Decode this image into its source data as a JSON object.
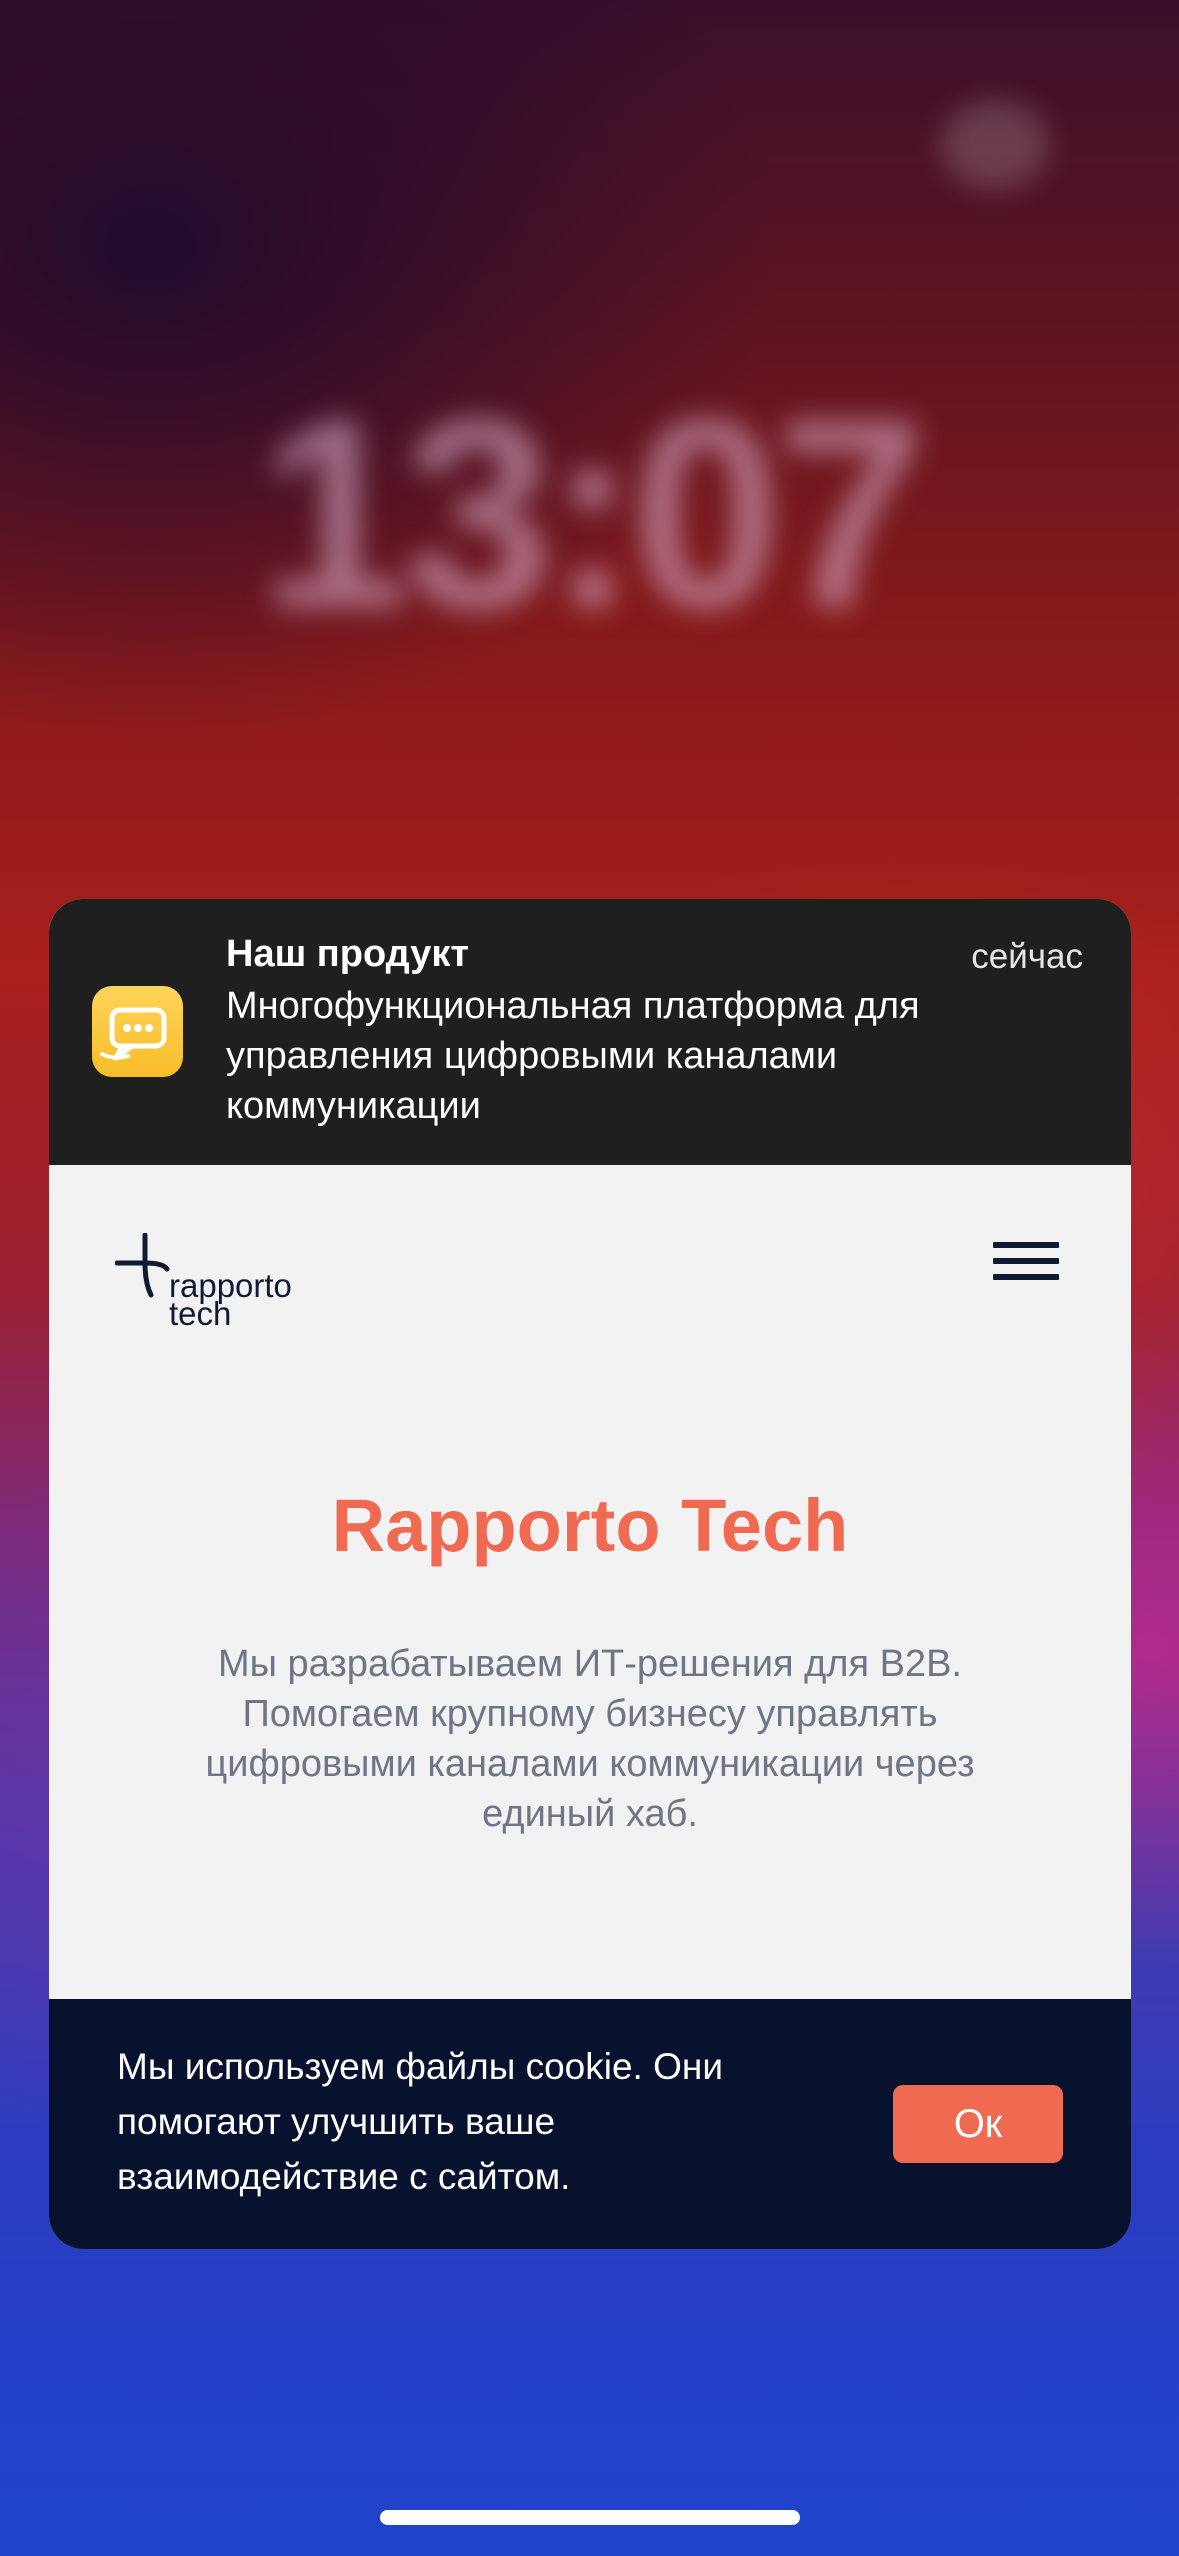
{
  "lockscreen": {
    "date": "",
    "time": "13:07"
  },
  "notification": {
    "app_icon": "chat-bubble-icon",
    "title": "Наш продукт",
    "time": "сейчас",
    "body": "Многофункциональная платформа для управления цифровыми каналами коммуникации"
  },
  "website": {
    "logo": {
      "line1": "rapporto",
      "line2": "tech"
    },
    "menu_icon": "hamburger-menu-icon",
    "title": "Rapporto Tech",
    "description": "Мы разрабатываем ИТ-решения для B2B. Помогаем крупному бизнесу управлять цифровыми каналами коммуникации через единый хаб."
  },
  "cookie_banner": {
    "text": "Мы используем файлы cookie. Они помогают улучшить ваше взаимодействие с сайтом.",
    "ok_label": "Ок"
  },
  "colors": {
    "accent": "#ef6a50",
    "notification_bg": "#1f1f1f",
    "cookie_bg": "#08122e",
    "app_icon_bg": "#f7bd2a"
  }
}
